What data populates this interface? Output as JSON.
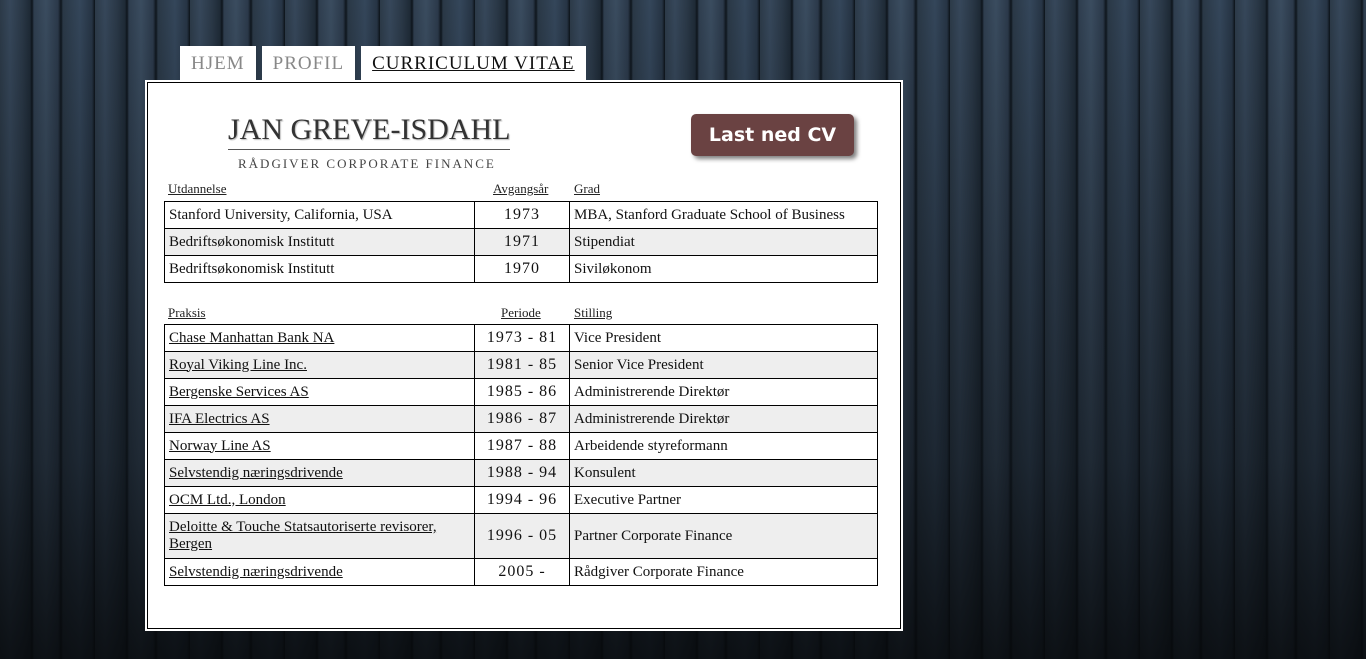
{
  "tabs": [
    {
      "label": "HJEM"
    },
    {
      "label": "PROFIL"
    },
    {
      "label": "CURRICULUM VITAE"
    }
  ],
  "header": {
    "name": "JAN GREVE-ISDAHL",
    "subtitle": "RÅDGIVER CORPORATE FINANCE",
    "download_label": "Last ned CV"
  },
  "education": {
    "headers": [
      "Utdannelse",
      "Avgangsår",
      "Grad"
    ],
    "rows": [
      [
        "Stanford University, California, USA",
        "1973",
        "MBA, Stanford Graduate School of Business"
      ],
      [
        "Bedriftsøkonomisk Institutt",
        "1971",
        "Stipendiat"
      ],
      [
        "Bedriftsøkonomisk Institutt",
        "1970",
        "Siviløkonom"
      ]
    ]
  },
  "practice": {
    "headers": [
      "Praksis",
      "Periode",
      "Stilling"
    ],
    "rows": [
      [
        "Chase Manhattan Bank NA",
        "1973 - 81",
        "Vice President"
      ],
      [
        "Royal Viking Line Inc.",
        "1981 - 85",
        "Senior Vice President"
      ],
      [
        "Bergenske Services AS",
        "1985 - 86",
        "Administrerende Direktør"
      ],
      [
        "IFA Electrics AS",
        "1986 - 87",
        "Administrerende Direktør"
      ],
      [
        "Norway Line AS",
        "1987 - 88",
        "Arbeidende styreformann"
      ],
      [
        "Selvstendig næringsdrivende",
        "1988 - 94",
        "Konsulent"
      ],
      [
        "OCM Ltd., London",
        "1994 - 96",
        "Executive Partner"
      ],
      [
        "Deloitte & Touche Statsautoriserte revisorer, Bergen",
        "1996 - 05",
        "Partner Corporate Finance"
      ],
      [
        "Selvstendig næringsdrivende",
        "2005 -",
        "Rådgiver Corporate Finance"
      ]
    ]
  }
}
